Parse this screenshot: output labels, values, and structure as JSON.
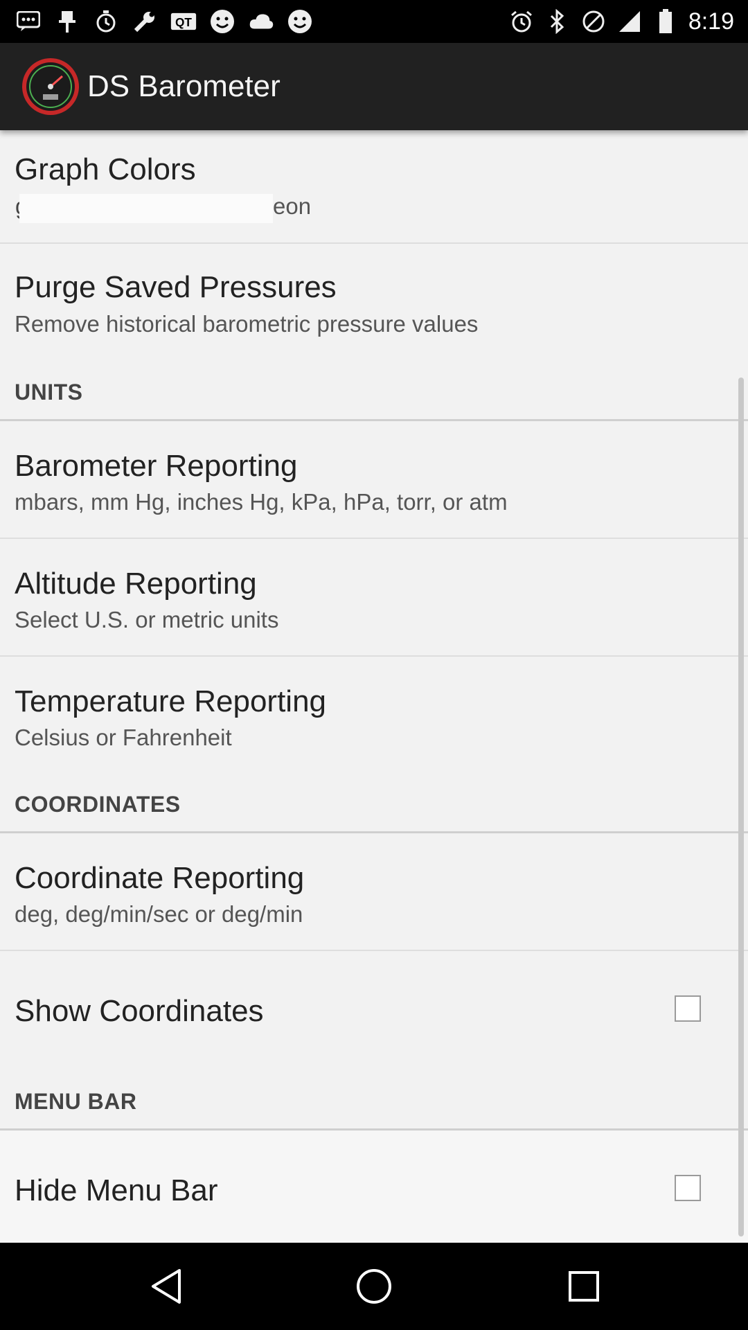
{
  "status_bar": {
    "time": "8:19",
    "icons": [
      "messages-icon",
      "pin-icon",
      "alarm-icon",
      "wrench-icon",
      "qt-icon",
      "emoji-icon",
      "cloud-icon",
      "emoji-icon",
      "alarm-icon",
      "bluetooth-icon",
      "do-not-disturb-icon",
      "signal-icon",
      "battery-icon"
    ],
    "qt_label": "QT"
  },
  "app_bar": {
    "title": "DS Barometer",
    "logo_icon": "barometer-gauge-icon"
  },
  "settings": {
    "graph_colors": {
      "title": "Graph Colors",
      "summary": "eon"
    },
    "purge": {
      "title": "Purge Saved Pressures",
      "summary": "Remove historical barometric pressure values"
    },
    "units_header": "UNITS",
    "barometer": {
      "title": "Barometer Reporting",
      "summary": "mbars, mm Hg, inches Hg, kPa, hPa, torr, or atm"
    },
    "altitude": {
      "title": "Altitude Reporting",
      "summary": "Select U.S. or metric units"
    },
    "temperature": {
      "title": "Temperature Reporting",
      "summary": "Celsius or Fahrenheit"
    },
    "coordinates_header": "COORDINATES",
    "coordinate_reporting": {
      "title": "Coordinate Reporting",
      "summary": "deg, deg/min/sec or deg/min"
    },
    "show_coordinates": {
      "title": "Show Coordinates",
      "checked": false
    },
    "menu_bar_header": "MENU BAR",
    "hide_menu_bar": {
      "title": "Hide Menu Bar",
      "checked": false
    }
  },
  "nav_bar": {
    "icons": [
      "back-icon",
      "home-icon",
      "recents-icon"
    ]
  },
  "colors": {
    "app_bar": "#212121",
    "background": "#f2f2f2",
    "status_bar": "#000000"
  }
}
